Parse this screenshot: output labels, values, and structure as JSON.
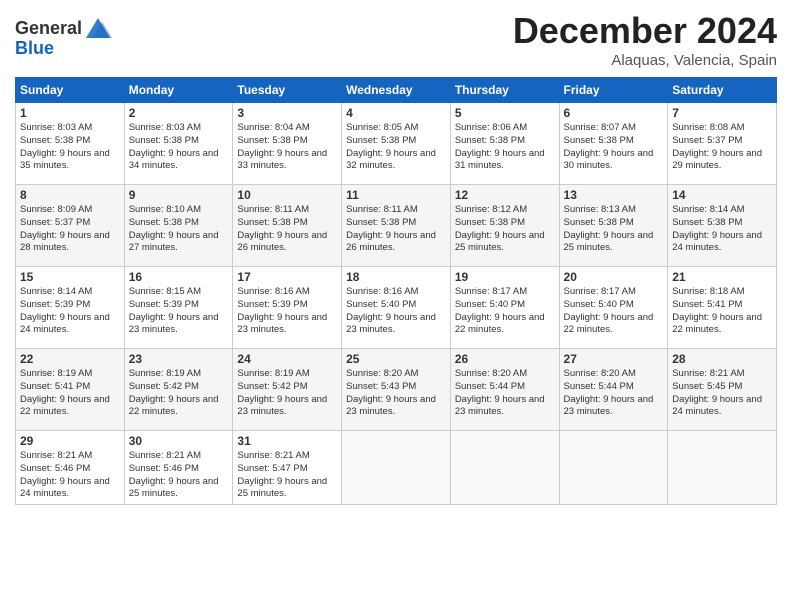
{
  "header": {
    "logo_general": "General",
    "logo_blue": "Blue",
    "month": "December 2024",
    "location": "Alaquas, Valencia, Spain"
  },
  "weekdays": [
    "Sunday",
    "Monday",
    "Tuesday",
    "Wednesday",
    "Thursday",
    "Friday",
    "Saturday"
  ],
  "weeks": [
    [
      {
        "day": "1",
        "sunrise": "Sunrise: 8:03 AM",
        "sunset": "Sunset: 5:38 PM",
        "daylight": "Daylight: 9 hours and 35 minutes."
      },
      {
        "day": "2",
        "sunrise": "Sunrise: 8:03 AM",
        "sunset": "Sunset: 5:38 PM",
        "daylight": "Daylight: 9 hours and 34 minutes."
      },
      {
        "day": "3",
        "sunrise": "Sunrise: 8:04 AM",
        "sunset": "Sunset: 5:38 PM",
        "daylight": "Daylight: 9 hours and 33 minutes."
      },
      {
        "day": "4",
        "sunrise": "Sunrise: 8:05 AM",
        "sunset": "Sunset: 5:38 PM",
        "daylight": "Daylight: 9 hours and 32 minutes."
      },
      {
        "day": "5",
        "sunrise": "Sunrise: 8:06 AM",
        "sunset": "Sunset: 5:38 PM",
        "daylight": "Daylight: 9 hours and 31 minutes."
      },
      {
        "day": "6",
        "sunrise": "Sunrise: 8:07 AM",
        "sunset": "Sunset: 5:38 PM",
        "daylight": "Daylight: 9 hours and 30 minutes."
      },
      {
        "day": "7",
        "sunrise": "Sunrise: 8:08 AM",
        "sunset": "Sunset: 5:37 PM",
        "daylight": "Daylight: 9 hours and 29 minutes."
      }
    ],
    [
      {
        "day": "8",
        "sunrise": "Sunrise: 8:09 AM",
        "sunset": "Sunset: 5:37 PM",
        "daylight": "Daylight: 9 hours and 28 minutes."
      },
      {
        "day": "9",
        "sunrise": "Sunrise: 8:10 AM",
        "sunset": "Sunset: 5:38 PM",
        "daylight": "Daylight: 9 hours and 27 minutes."
      },
      {
        "day": "10",
        "sunrise": "Sunrise: 8:11 AM",
        "sunset": "Sunset: 5:38 PM",
        "daylight": "Daylight: 9 hours and 26 minutes."
      },
      {
        "day": "11",
        "sunrise": "Sunrise: 8:11 AM",
        "sunset": "Sunset: 5:38 PM",
        "daylight": "Daylight: 9 hours and 26 minutes."
      },
      {
        "day": "12",
        "sunrise": "Sunrise: 8:12 AM",
        "sunset": "Sunset: 5:38 PM",
        "daylight": "Daylight: 9 hours and 25 minutes."
      },
      {
        "day": "13",
        "sunrise": "Sunrise: 8:13 AM",
        "sunset": "Sunset: 5:38 PM",
        "daylight": "Daylight: 9 hours and 25 minutes."
      },
      {
        "day": "14",
        "sunrise": "Sunrise: 8:14 AM",
        "sunset": "Sunset: 5:38 PM",
        "daylight": "Daylight: 9 hours and 24 minutes."
      }
    ],
    [
      {
        "day": "15",
        "sunrise": "Sunrise: 8:14 AM",
        "sunset": "Sunset: 5:39 PM",
        "daylight": "Daylight: 9 hours and 24 minutes."
      },
      {
        "day": "16",
        "sunrise": "Sunrise: 8:15 AM",
        "sunset": "Sunset: 5:39 PM",
        "daylight": "Daylight: 9 hours and 23 minutes."
      },
      {
        "day": "17",
        "sunrise": "Sunrise: 8:16 AM",
        "sunset": "Sunset: 5:39 PM",
        "daylight": "Daylight: 9 hours and 23 minutes."
      },
      {
        "day": "18",
        "sunrise": "Sunrise: 8:16 AM",
        "sunset": "Sunset: 5:40 PM",
        "daylight": "Daylight: 9 hours and 23 minutes."
      },
      {
        "day": "19",
        "sunrise": "Sunrise: 8:17 AM",
        "sunset": "Sunset: 5:40 PM",
        "daylight": "Daylight: 9 hours and 22 minutes."
      },
      {
        "day": "20",
        "sunrise": "Sunrise: 8:17 AM",
        "sunset": "Sunset: 5:40 PM",
        "daylight": "Daylight: 9 hours and 22 minutes."
      },
      {
        "day": "21",
        "sunrise": "Sunrise: 8:18 AM",
        "sunset": "Sunset: 5:41 PM",
        "daylight": "Daylight: 9 hours and 22 minutes."
      }
    ],
    [
      {
        "day": "22",
        "sunrise": "Sunrise: 8:19 AM",
        "sunset": "Sunset: 5:41 PM",
        "daylight": "Daylight: 9 hours and 22 minutes."
      },
      {
        "day": "23",
        "sunrise": "Sunrise: 8:19 AM",
        "sunset": "Sunset: 5:42 PM",
        "daylight": "Daylight: 9 hours and 22 minutes."
      },
      {
        "day": "24",
        "sunrise": "Sunrise: 8:19 AM",
        "sunset": "Sunset: 5:42 PM",
        "daylight": "Daylight: 9 hours and 23 minutes."
      },
      {
        "day": "25",
        "sunrise": "Sunrise: 8:20 AM",
        "sunset": "Sunset: 5:43 PM",
        "daylight": "Daylight: 9 hours and 23 minutes."
      },
      {
        "day": "26",
        "sunrise": "Sunrise: 8:20 AM",
        "sunset": "Sunset: 5:44 PM",
        "daylight": "Daylight: 9 hours and 23 minutes."
      },
      {
        "day": "27",
        "sunrise": "Sunrise: 8:20 AM",
        "sunset": "Sunset: 5:44 PM",
        "daylight": "Daylight: 9 hours and 23 minutes."
      },
      {
        "day": "28",
        "sunrise": "Sunrise: 8:21 AM",
        "sunset": "Sunset: 5:45 PM",
        "daylight": "Daylight: 9 hours and 24 minutes."
      }
    ],
    [
      {
        "day": "29",
        "sunrise": "Sunrise: 8:21 AM",
        "sunset": "Sunset: 5:46 PM",
        "daylight": "Daylight: 9 hours and 24 minutes."
      },
      {
        "day": "30",
        "sunrise": "Sunrise: 8:21 AM",
        "sunset": "Sunset: 5:46 PM",
        "daylight": "Daylight: 9 hours and 25 minutes."
      },
      {
        "day": "31",
        "sunrise": "Sunrise: 8:21 AM",
        "sunset": "Sunset: 5:47 PM",
        "daylight": "Daylight: 9 hours and 25 minutes."
      },
      null,
      null,
      null,
      null
    ]
  ]
}
